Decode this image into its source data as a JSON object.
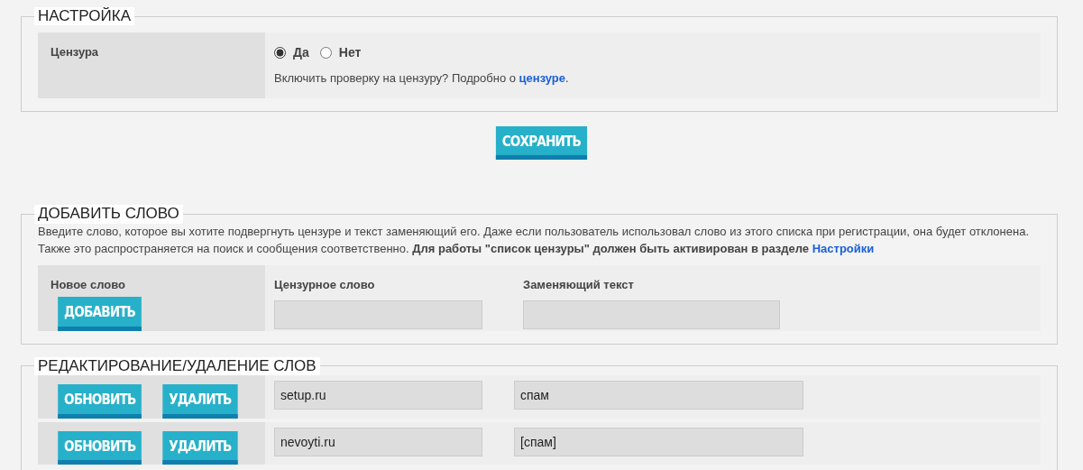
{
  "settings": {
    "legend": "НАСТРОЙКА",
    "row": {
      "label": "Цензура",
      "options": [
        {
          "label": "Да",
          "selected": true
        },
        {
          "label": "Нет",
          "selected": false
        }
      ],
      "hint": {
        "text": "Включить проверку на цензуру? Подробно о",
        "link": "цензуре",
        "after": "."
      }
    },
    "save_button": "СОХРАНИТЬ"
  },
  "add_word": {
    "legend": "ДОБАВИТЬ СЛОВО",
    "description": {
      "text": "Введите слово, которое вы хотите подвергнуть цензуре и текст заменяющий его. Даже если пользователь использовал слово из этого списка при регистрации, она будет отклонена. Также это распространяется на поиск и сообщения соответственно. **Для работы \"список цензуры\" должен быть активирован в разделе**",
      "link": "Настройки"
    },
    "new_word_label": "Новое слово",
    "add_button": "ДОБАВИТЬ",
    "word_label": "Цензурное слово",
    "replacement_label": "Заменяющий текст"
  },
  "edit_words": {
    "legend": "РЕДАКТИРОВАНИЕ/УДАЛЕНИЕ СЛОВ",
    "rows": [
      {
        "update_button": "ОБНОВИТЬ",
        "delete_button": "УДАЛИТЬ",
        "word": "setup.ru",
        "replacement": "спам"
      },
      {
        "update_button": "ОБНОВИТЬ",
        "delete_button": "УДАЛИТЬ",
        "word": "nevoyti.ru",
        "replacement": "[спам]"
      }
    ]
  }
}
